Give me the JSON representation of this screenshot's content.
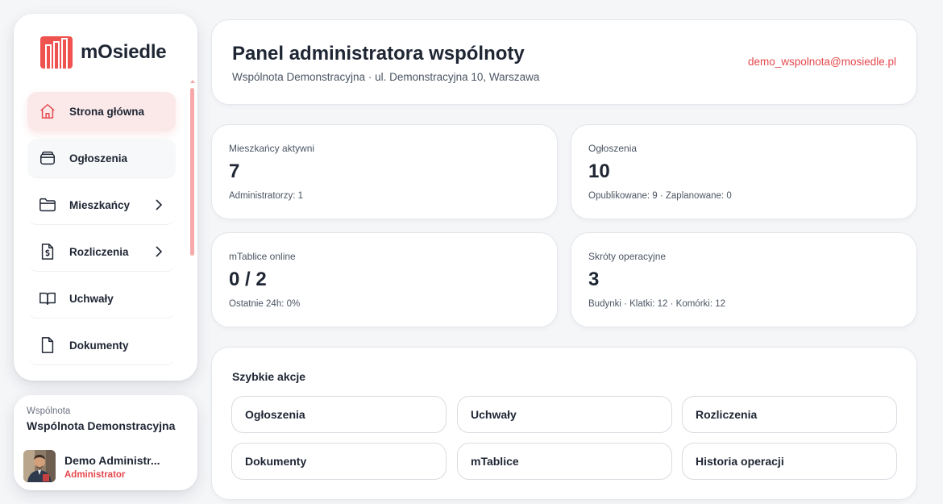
{
  "app": {
    "name": "mOsiedle"
  },
  "sidebar": {
    "items": [
      {
        "label": "Strona główna",
        "icon": "home-icon"
      },
      {
        "label": "Ogłoszenia",
        "icon": "inbox-icon"
      },
      {
        "label": "Mieszkańcy",
        "icon": "folder-icon",
        "has_submenu": true
      },
      {
        "label": "Rozliczenia",
        "icon": "invoice-icon",
        "has_submenu": true
      },
      {
        "label": "Uchwały",
        "icon": "book-icon"
      },
      {
        "label": "Dokumenty",
        "icon": "document-icon"
      }
    ],
    "active_index": 0
  },
  "community": {
    "label": "Wspólnota",
    "name": "Wspólnota Demonstracyjna"
  },
  "user": {
    "name": "Demo Administr...",
    "role": "Administrator"
  },
  "header": {
    "title": "Panel administratora wspólnoty",
    "subtitle": "Wspólnota Demonstracyjna · ul. Demonstracyjna 10, Warszawa",
    "email": "demo_wspolnota@mosiedle.pl"
  },
  "stats": [
    {
      "label": "Mieszkańcy aktywni",
      "value": "7",
      "sub": "Administratorzy: 1"
    },
    {
      "label": "Ogłoszenia",
      "value": "10",
      "sub": "Opublikowane: 9 · Zaplanowane: 0"
    },
    {
      "label": "mTablice online",
      "value": "0 / 2",
      "sub": "Ostatnie 24h: 0%"
    },
    {
      "label": "Skróty operacyjne",
      "value": "3",
      "sub": "Budynki · Klatki: 12 · Komórki: 12"
    }
  ],
  "quick_actions": {
    "title": "Szybkie akcje",
    "buttons": [
      "Ogłoszenia",
      "Uchwały",
      "Rozliczenia",
      "Dokumenty",
      "mTablice",
      "Historia operacji"
    ]
  },
  "colors": {
    "accent": "#e5484d",
    "active_bg": "#fbe9e9",
    "page_bg": "#f5f6f8"
  }
}
